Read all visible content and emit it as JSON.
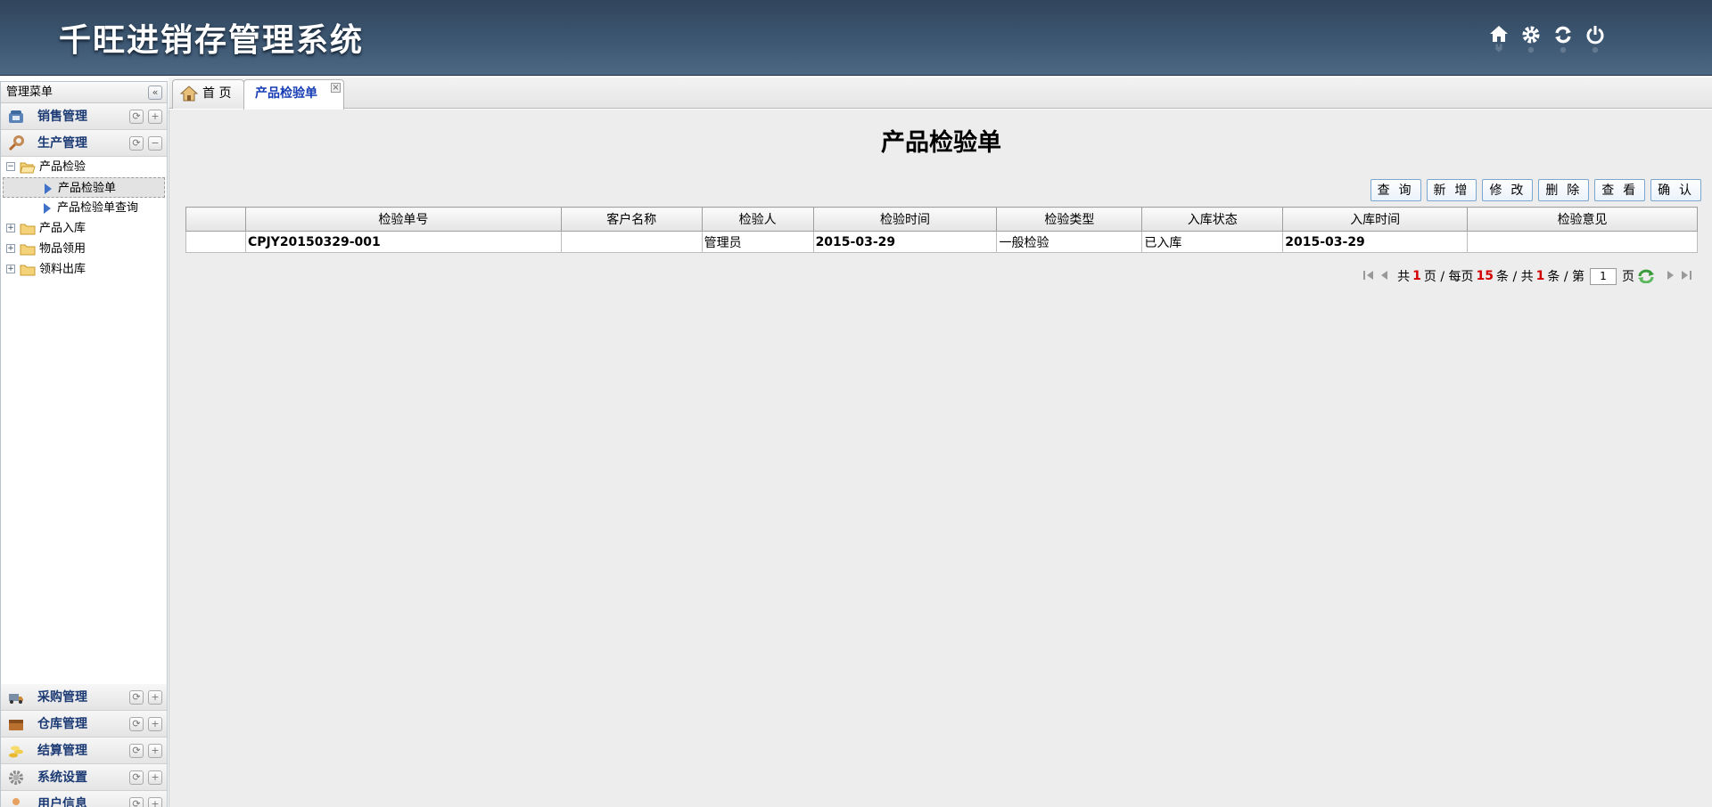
{
  "header": {
    "title": "千旺进销存管理系统",
    "tools": [
      "home-icon",
      "gear-icon",
      "refresh-icon",
      "power-icon"
    ]
  },
  "sidebar": {
    "title": "管理菜单",
    "collapse_glyph": "«",
    "top_sections": [
      {
        "label": "销售管理",
        "icon": "phone-icon",
        "toggle": "+"
      },
      {
        "label": "生产管理",
        "icon": "wrench-icon",
        "toggle": "−"
      }
    ],
    "tree": [
      {
        "label": "产品检验",
        "expanded": true,
        "children": [
          {
            "label": "产品检验单",
            "selected": true
          },
          {
            "label": "产品检验单查询",
            "selected": false
          }
        ]
      },
      {
        "label": "产品入库",
        "expanded": false
      },
      {
        "label": "物品领用",
        "expanded": false
      },
      {
        "label": "领料出库",
        "expanded": false
      }
    ],
    "bottom_sections": [
      {
        "label": "采购管理",
        "icon": "truck-icon"
      },
      {
        "label": "仓库管理",
        "icon": "box-icon"
      },
      {
        "label": "结算管理",
        "icon": "coins-icon"
      },
      {
        "label": "系统设置",
        "icon": "gear-icon"
      },
      {
        "label": "用户信息",
        "icon": "user-icon"
      }
    ]
  },
  "tabs": {
    "home": "首 页",
    "active": "产品检验单",
    "close_glyph": "×"
  },
  "main": {
    "page_title": "产品检验单",
    "toolbar": [
      "查 询",
      "新 增",
      "修 改",
      "删 除",
      "查 看",
      "确 认"
    ],
    "table": {
      "headers": [
        "",
        "检验单号",
        "客户名称",
        "检验人",
        "检验时间",
        "检验类型",
        "入库状态",
        "入库时间",
        "检验意见"
      ],
      "rows": [
        [
          "",
          "CPJY20150329-001",
          "",
          "管理员",
          "2015-03-29",
          "一般检验",
          "已入库",
          "2015-03-29",
          ""
        ]
      ]
    },
    "pager": {
      "t1": "共",
      "pages": "1",
      "t2": "页 / 每页",
      "per_page": "15",
      "t3": "条 / 共",
      "total": "1",
      "t4": "条 / 第",
      "current": "1",
      "t5": "页"
    }
  }
}
